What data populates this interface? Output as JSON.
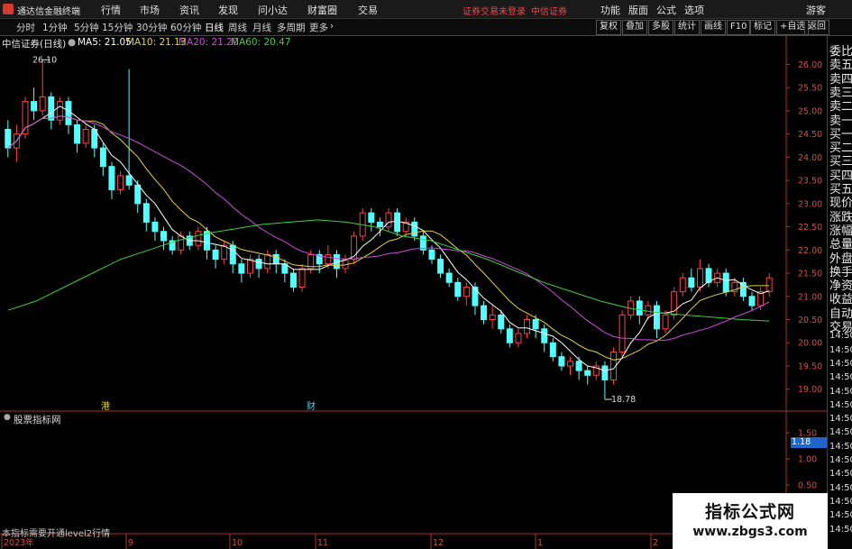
{
  "app": {
    "title": "通达信金融终端"
  },
  "menu": {
    "items": [
      "行情",
      "市场",
      "资讯",
      "发现",
      "问小达",
      "财富圈",
      "交易"
    ],
    "status1": "证券交易未登录",
    "status2": "中信证券",
    "right": [
      "功能",
      "版面",
      "公式",
      "选项"
    ],
    "guest": "游客"
  },
  "toolbar": {
    "periods": [
      "分时",
      "1分钟",
      "5分钟",
      "15分钟",
      "30分钟",
      "60分钟",
      "日线",
      "周线",
      "月线",
      "多周期",
      "更多"
    ],
    "buttons": [
      "复权",
      "叠加",
      "多股",
      "统计",
      "画线",
      "F10",
      "标记",
      "+自选",
      "返回"
    ]
  },
  "stock": {
    "title": "中信证券(日线)",
    "ma5": "MA5: 21.05",
    "ma10": "MA10: 21.13",
    "ma20": "MA20: 21.20",
    "ma60": "MA60: 20.47",
    "high_label": "26.10",
    "low_label": "18.78",
    "tag_gang": "港",
    "tag_cai": "财"
  },
  "price_axis": [
    "26.00",
    "25.50",
    "25.00",
    "24.50",
    "24.00",
    "23.50",
    "23.00",
    "22.50",
    "22.00",
    "21.50",
    "21.00",
    "20.50",
    "20.00",
    "19.50",
    "19.00"
  ],
  "time_axis": [
    "2023年",
    "9",
    "10",
    "11",
    "12",
    "1",
    "2"
  ],
  "indicator": {
    "title": "股票指标网",
    "ticks": [
      "1.50",
      "1.00",
      "0.50"
    ],
    "value": "1.18",
    "note": "本指标需要开通level2行情"
  },
  "side_panel": [
    "委比",
    "卖五",
    "卖四",
    "卖三",
    "卖二",
    "卖一",
    "买一",
    "买二",
    "买三",
    "买四",
    "买五",
    "现价",
    "涨跌",
    "涨幅",
    "总量",
    "外盘",
    "换手",
    "净资",
    "收益",
    "自动",
    "交易",
    "14:50",
    "14:50",
    "14:50",
    "14:50",
    "14:50",
    "14:50",
    "14:50",
    "14:50",
    "14:50",
    "14:50",
    "14:50",
    "14:50",
    "14:50",
    "14:50",
    "14:50"
  ],
  "watermark": {
    "title": "指标公式网",
    "url": "www.zbgs3.com"
  },
  "colors": {
    "up": "#ff4040",
    "down": "#54ffff",
    "ma5": "#ffffff",
    "ma10": "#e6d23c",
    "ma20": "#d24be0",
    "ma60": "#3cd23c",
    "axis": "#b03030"
  },
  "chart_data": {
    "type": "candlestick",
    "ylim": [
      18.8,
      26.3
    ],
    "candles": [
      [
        24.6,
        24.2,
        24.8,
        24.0
      ],
      [
        24.2,
        24.5,
        24.7,
        23.9
      ],
      [
        24.5,
        25.2,
        25.3,
        24.4
      ],
      [
        25.2,
        25.0,
        25.5,
        24.8
      ],
      [
        25.0,
        25.3,
        26.1,
        24.9
      ],
      [
        25.3,
        24.8,
        25.4,
        24.6
      ],
      [
        24.8,
        25.2,
        25.3,
        24.7
      ],
      [
        25.2,
        24.7,
        25.3,
        24.5
      ],
      [
        24.7,
        24.3,
        24.8,
        24.1
      ],
      [
        24.3,
        24.6,
        24.7,
        24.2
      ],
      [
        24.6,
        24.2,
        24.7,
        24.0
      ],
      [
        24.2,
        23.8,
        24.3,
        23.6
      ],
      [
        23.8,
        23.3,
        23.9,
        23.1
      ],
      [
        23.3,
        23.6,
        23.7,
        23.2
      ],
      [
        23.6,
        23.4,
        25.9,
        23.3
      ],
      [
        23.4,
        23.0,
        23.5,
        22.8
      ],
      [
        23.0,
        22.6,
        23.1,
        22.4
      ],
      [
        22.6,
        22.4,
        22.7,
        22.2
      ],
      [
        22.4,
        22.2,
        22.5,
        22.0
      ],
      [
        22.2,
        22.0,
        22.3,
        21.9
      ],
      [
        22.0,
        22.3,
        22.4,
        21.9
      ],
      [
        22.3,
        22.1,
        22.4,
        22.0
      ],
      [
        22.1,
        22.4,
        22.5,
        22.0
      ],
      [
        22.4,
        22.0,
        22.5,
        21.8
      ],
      [
        22.0,
        21.8,
        22.1,
        21.6
      ],
      [
        21.8,
        22.1,
        22.2,
        21.7
      ],
      [
        22.1,
        21.7,
        22.2,
        21.5
      ],
      [
        21.7,
        21.5,
        21.8,
        21.3
      ],
      [
        21.5,
        21.8,
        21.9,
        21.4
      ],
      [
        21.8,
        21.6,
        21.9,
        21.4
      ],
      [
        21.6,
        21.9,
        22.0,
        21.5
      ],
      [
        21.9,
        21.7,
        22.0,
        21.5
      ],
      [
        21.7,
        21.5,
        21.8,
        21.3
      ],
      [
        21.5,
        21.2,
        21.6,
        21.1
      ],
      [
        21.2,
        21.6,
        21.7,
        21.1
      ],
      [
        21.6,
        21.9,
        22.0,
        21.5
      ],
      [
        21.9,
        21.7,
        22.0,
        21.5
      ],
      [
        21.7,
        21.9,
        22.1,
        21.6
      ],
      [
        21.9,
        21.6,
        22.0,
        21.4
      ],
      [
        21.6,
        21.8,
        21.9,
        21.5
      ],
      [
        21.8,
        22.3,
        22.4,
        21.7
      ],
      [
        22.3,
        22.8,
        22.9,
        22.2
      ],
      [
        22.8,
        22.6,
        22.9,
        22.4
      ],
      [
        22.6,
        22.5,
        22.7,
        22.3
      ],
      [
        22.5,
        22.8,
        22.9,
        22.4
      ],
      [
        22.8,
        22.4,
        22.9,
        22.3
      ],
      [
        22.4,
        22.6,
        22.7,
        22.3
      ],
      [
        22.6,
        22.3,
        22.7,
        22.2
      ],
      [
        22.3,
        22.0,
        22.4,
        21.9
      ],
      [
        22.0,
        21.8,
        22.1,
        21.7
      ],
      [
        21.8,
        21.5,
        21.9,
        21.4
      ],
      [
        21.5,
        21.3,
        21.6,
        21.2
      ],
      [
        21.3,
        21.0,
        21.4,
        20.9
      ],
      [
        21.0,
        21.2,
        21.3,
        20.8
      ],
      [
        21.2,
        20.8,
        21.3,
        20.6
      ],
      [
        20.8,
        20.5,
        20.9,
        20.4
      ],
      [
        20.5,
        20.6,
        20.8,
        20.3
      ],
      [
        20.6,
        20.3,
        20.7,
        20.2
      ],
      [
        20.3,
        20.0,
        20.4,
        19.9
      ],
      [
        20.0,
        20.2,
        20.3,
        19.9
      ],
      [
        20.2,
        20.5,
        20.6,
        20.1
      ],
      [
        20.5,
        20.3,
        20.6,
        20.1
      ],
      [
        20.3,
        20.0,
        20.4,
        19.8
      ],
      [
        20.0,
        19.7,
        20.1,
        19.6
      ],
      [
        19.7,
        19.5,
        19.8,
        19.4
      ],
      [
        19.5,
        19.6,
        19.7,
        19.3
      ],
      [
        19.6,
        19.4,
        19.7,
        19.2
      ],
      [
        19.4,
        19.3,
        19.5,
        19.1
      ],
      [
        19.3,
        19.5,
        19.6,
        19.2
      ],
      [
        19.5,
        19.2,
        19.6,
        18.78
      ],
      [
        19.2,
        19.8,
        19.9,
        19.1
      ],
      [
        19.8,
        20.6,
        20.7,
        19.7
      ],
      [
        20.6,
        20.9,
        21.0,
        20.5
      ],
      [
        20.9,
        20.6,
        21.0,
        20.4
      ],
      [
        20.6,
        20.8,
        20.9,
        20.5
      ],
      [
        20.8,
        20.3,
        20.9,
        20.1
      ],
      [
        20.3,
        20.6,
        20.7,
        20.2
      ],
      [
        20.6,
        21.1,
        21.2,
        20.5
      ],
      [
        21.1,
        21.4,
        21.5,
        21.0
      ],
      [
        21.4,
        21.2,
        21.6,
        21.1
      ],
      [
        21.2,
        21.6,
        21.8,
        21.1
      ],
      [
        21.6,
        21.3,
        21.7,
        21.2
      ],
      [
        21.3,
        21.5,
        21.6,
        21.2
      ],
      [
        21.5,
        21.1,
        21.6,
        21.0
      ],
      [
        21.1,
        21.3,
        21.4,
        21.0
      ],
      [
        21.3,
        21.0,
        21.4,
        20.9
      ],
      [
        21.0,
        20.8,
        21.1,
        20.7
      ],
      [
        20.8,
        21.1,
        21.2,
        20.7
      ],
      [
        21.1,
        21.4,
        21.5,
        21.0
      ]
    ],
    "ma60": [
      20.7,
      20.9,
      21.2,
      21.5,
      21.8,
      22.0,
      22.2,
      22.35,
      22.45,
      22.55,
      22.6,
      22.65,
      22.6,
      22.5,
      22.3,
      22.2,
      22.0,
      21.8,
      21.55,
      21.3,
      21.1,
      20.9,
      20.75,
      20.65,
      20.6,
      20.55,
      20.5,
      20.47
    ]
  }
}
